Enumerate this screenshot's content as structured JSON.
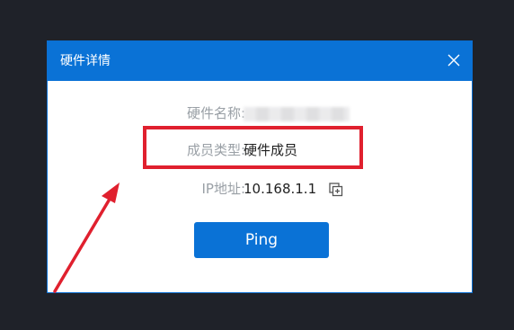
{
  "dialog": {
    "title": "硬件详情",
    "close_icon": "close-icon",
    "rows": [
      {
        "label": "硬件名称:",
        "value": ""
      },
      {
        "label": "成员类型:",
        "value": "硬件成员"
      },
      {
        "label": "IP地址:",
        "value": "10.168.1.1",
        "action_icon": "copy-icon"
      }
    ],
    "ping_label": "Ping"
  },
  "colors": {
    "accent": "#0a72d6",
    "background": "#1f2229",
    "highlight": "#e0202e",
    "label": "#9aa0a6"
  }
}
